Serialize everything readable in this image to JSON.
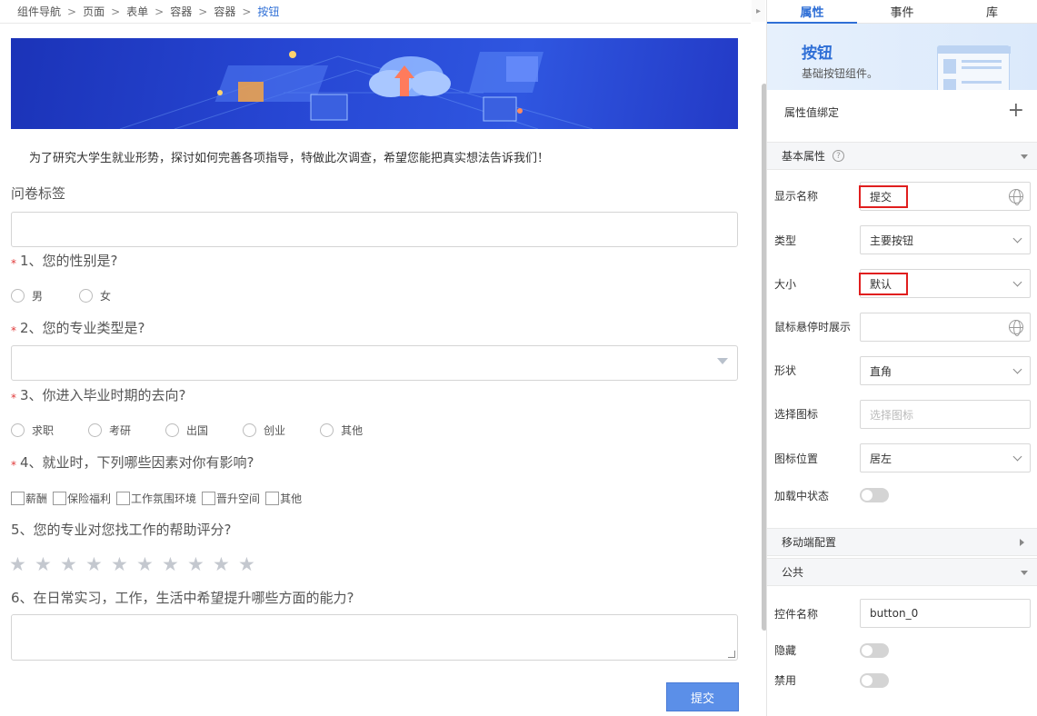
{
  "breadcrumb": {
    "items": [
      "组件导航",
      "页面",
      "表单",
      "容器",
      "容器"
    ],
    "current": "按钮"
  },
  "form": {
    "intro": "为了研究大学生就业形势，探讨如何完善各项指导，特做此次调查，希望您能把真实想法告诉我们！",
    "label_tag": "问卷标签",
    "q1": {
      "text": "1、您的性别是?",
      "options": [
        "男",
        "女"
      ]
    },
    "q2": {
      "text": "2、您的专业类型是?"
    },
    "q3": {
      "text": "3、你进入毕业时期的去向?",
      "options": [
        "求职",
        "考研",
        "出国",
        "创业",
        "其他"
      ]
    },
    "q4": {
      "text": "4、就业时，下列哪些因素对你有影响?",
      "options": [
        "薪酬",
        "保险福利",
        "工作氛围环境",
        "晋升空间",
        "其他"
      ]
    },
    "q5": {
      "text": "5、您的专业对您找工作的帮助评分?",
      "rating_max": 10,
      "rating_value": 0
    },
    "q6": {
      "text": "6、在日常实习，工作，生活中希望提升哪些方面的能力?"
    },
    "required_mark": "*",
    "submit_label": "提交"
  },
  "panel": {
    "tabs": [
      "属性",
      "事件",
      "库"
    ],
    "active_tab": "属性",
    "component": {
      "title": "按钮",
      "desc": "基础按钮组件。"
    },
    "binding_label": "属性值绑定",
    "basic_section": "基本属性",
    "help_icon": "?",
    "props": {
      "display_name_label": "显示名称",
      "display_name_value": "提交",
      "type_label": "类型",
      "type_value": "主要按钮",
      "size_label": "大小",
      "size_value": "默认",
      "hover_label": "鼠标悬停时展示",
      "shape_label": "形状",
      "shape_value": "直角",
      "icon_label": "选择图标",
      "icon_placeholder": "选择图标",
      "icon_pos_label": "图标位置",
      "icon_pos_value": "居左",
      "loading_label": "加载中状态"
    },
    "mobile_section": "移动端配置",
    "public_section": "公共",
    "public": {
      "control_name_label": "控件名称",
      "control_name_value": "button_0",
      "hidden_label": "隐藏",
      "disabled_label": "禁用"
    },
    "colors": {
      "accent": "#2f6fd6",
      "highlight": "#e01e1e",
      "submit": "#5b8fe8"
    }
  }
}
